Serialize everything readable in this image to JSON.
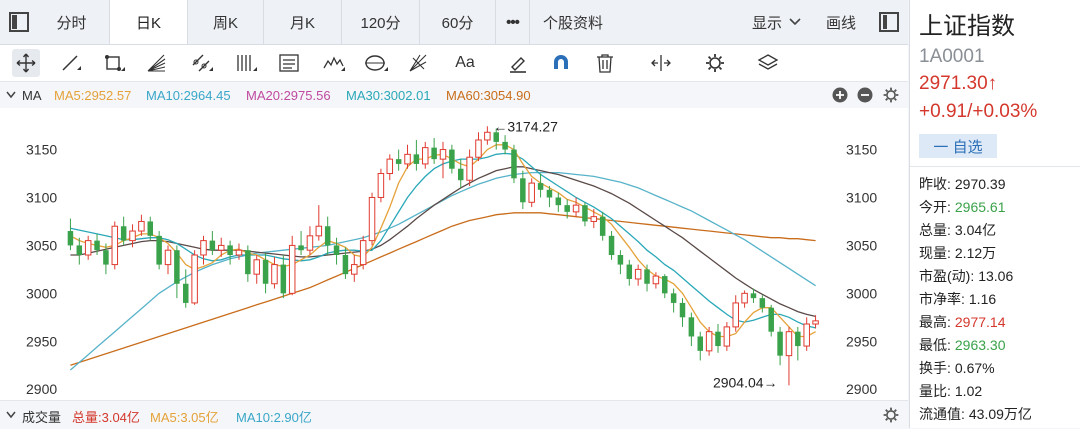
{
  "tabs": [
    {
      "label": "分时"
    },
    {
      "label": "日K"
    },
    {
      "label": "周K"
    },
    {
      "label": "月K"
    },
    {
      "label": "120分"
    },
    {
      "label": "60分"
    }
  ],
  "more_label": "•••",
  "profile_tab": "个股资料",
  "display_label": "显示",
  "draw_label": "画线",
  "ma_bar": {
    "label": "MA",
    "ma5": "MA5:2952.57",
    "ma10": "MA10:2964.45",
    "ma20": "MA20:2975.56",
    "ma30": "MA30:3002.01",
    "ma60": "MA60:3054.90"
  },
  "volume_bar": {
    "label": "成交量",
    "total": "总量:3.04亿",
    "ma5": "MA5:3.05亿",
    "ma10": "MA10:2.90亿"
  },
  "colors": {
    "up": "#e03a2f",
    "down": "#3aa24a",
    "ma5": "#e5a23a",
    "ma10": "#3aa7c8",
    "ma20": "#c04aa0",
    "ma30": "#2aa8b8",
    "ma60": "#c96d1c",
    "ma10_line": "#57b3c9",
    "ma20_line": "#5a4a48"
  },
  "chart_data": {
    "type": "candlestick",
    "y_ticks": [
      "3150",
      "3100",
      "3050",
      "3000",
      "2950",
      "2900"
    ],
    "ylim": [
      2895,
      3185
    ],
    "high_label": "←3174.27",
    "low_label": "2904.04→",
    "high_value": 3174.27,
    "low_value": 2904.04,
    "candles": [
      [
        3065,
        3050,
        3078,
        3045
      ],
      [
        3050,
        3040,
        3058,
        3030
      ],
      [
        3040,
        3055,
        3060,
        3035
      ],
      [
        3055,
        3045,
        3062,
        3040
      ],
      [
        3045,
        3030,
        3052,
        3020
      ],
      [
        3030,
        3070,
        3075,
        3025
      ],
      [
        3070,
        3055,
        3080,
        3050
      ],
      [
        3055,
        3065,
        3072,
        3048
      ],
      [
        3065,
        3075,
        3082,
        3060
      ],
      [
        3075,
        3060,
        3080,
        3055
      ],
      [
        3060,
        3030,
        3065,
        3025
      ],
      [
        3030,
        3045,
        3050,
        3020
      ],
      [
        3045,
        3010,
        3050,
        2995
      ],
      [
        3010,
        2990,
        3025,
        2985
      ],
      [
        2990,
        3040,
        3045,
        2988
      ],
      [
        3040,
        3055,
        3060,
        3030
      ],
      [
        3055,
        3045,
        3065,
        3040
      ],
      [
        3045,
        3050,
        3058,
        3038
      ],
      [
        3050,
        3040,
        3055,
        3030
      ],
      [
        3040,
        3045,
        3052,
        3035
      ],
      [
        3045,
        3020,
        3050,
        3012
      ],
      [
        3020,
        3035,
        3040,
        3010
      ],
      [
        3035,
        3010,
        3042,
        3000
      ],
      [
        3010,
        3030,
        3038,
        3005
      ],
      [
        3030,
        3000,
        3040,
        2995
      ],
      [
        3000,
        3050,
        3060,
        2998
      ],
      [
        3050,
        3045,
        3065,
        3040
      ],
      [
        3045,
        3060,
        3070,
        3040
      ],
      [
        3060,
        3070,
        3092,
        3055
      ],
      [
        3070,
        3050,
        3080,
        3040
      ],
      [
        3050,
        3040,
        3058,
        3030
      ],
      [
        3040,
        3020,
        3048,
        3015
      ],
      [
        3020,
        3030,
        3040,
        3012
      ],
      [
        3030,
        3055,
        3060,
        3025
      ],
      [
        3055,
        3100,
        3105,
        3050
      ],
      [
        3100,
        3125,
        3130,
        3095
      ],
      [
        3125,
        3140,
        3145,
        3118
      ],
      [
        3140,
        3135,
        3150,
        3128
      ],
      [
        3135,
        3145,
        3155,
        3130
      ],
      [
        3145,
        3135,
        3160,
        3128
      ],
      [
        3135,
        3152,
        3158,
        3130
      ],
      [
        3152,
        3140,
        3162,
        3135
      ],
      [
        3140,
        3150,
        3158,
        3120
      ],
      [
        3150,
        3130,
        3155,
        3125
      ],
      [
        3130,
        3118,
        3140,
        3110
      ],
      [
        3118,
        3142,
        3150,
        3112
      ],
      [
        3142,
        3160,
        3168,
        3138
      ],
      [
        3160,
        3168,
        3174.27,
        3155
      ],
      [
        3168,
        3158,
        3172,
        3150
      ],
      [
        3158,
        3150,
        3165,
        3145
      ],
      [
        3150,
        3120,
        3155,
        3115
      ],
      [
        3120,
        3095,
        3128,
        3088
      ],
      [
        3095,
        3115,
        3120,
        3090
      ],
      [
        3115,
        3108,
        3125,
        3100
      ],
      [
        3108,
        3100,
        3112,
        3090
      ],
      [
        3100,
        3092,
        3105,
        3085
      ],
      [
        3092,
        3085,
        3098,
        3078
      ],
      [
        3085,
        3092,
        3100,
        3080
      ],
      [
        3092,
        3075,
        3095,
        3070
      ],
      [
        3075,
        3080,
        3088,
        3068
      ],
      [
        3080,
        3060,
        3085,
        3055
      ],
      [
        3060,
        3040,
        3065,
        3035
      ],
      [
        3040,
        3030,
        3045,
        3020
      ],
      [
        3030,
        3015,
        3035,
        3008
      ],
      [
        3015,
        3025,
        3030,
        3008
      ],
      [
        3025,
        3010,
        3030,
        3002
      ],
      [
        3010,
        3018,
        3022,
        3005
      ],
      [
        3018,
        3000,
        3020,
        2995
      ],
      [
        3000,
        2990,
        3005,
        2980
      ],
      [
        2990,
        2975,
        2995,
        2965
      ],
      [
        2975,
        2955,
        2980,
        2945
      ],
      [
        2955,
        2940,
        2960,
        2930
      ],
      [
        2940,
        2960,
        2965,
        2935
      ],
      [
        2960,
        2945,
        2968,
        2938
      ],
      [
        2945,
        2965,
        2970,
        2940
      ],
      [
        2965,
        2990,
        2998,
        2960
      ],
      [
        2990,
        3000,
        3003,
        2985
      ],
      [
        3000,
        2995,
        3005,
        2990
      ],
      [
        2995,
        2985,
        2998,
        2980
      ],
      [
        2985,
        2960,
        2988,
        2955
      ],
      [
        2960,
        2935,
        2965,
        2925
      ],
      [
        2935,
        2960,
        2965,
        2904.04
      ],
      [
        2960,
        2945,
        2965,
        2930
      ],
      [
        2945,
        2968,
        2975,
        2940
      ],
      [
        2968,
        2971.3,
        2977.14,
        2963.3
      ]
    ],
    "ma5": [
      3060,
      3055,
      3052,
      3050,
      3048,
      3050,
      3055,
      3058,
      3062,
      3062,
      3058,
      3052,
      3042,
      3030,
      3025,
      3028,
      3032,
      3040,
      3045,
      3046,
      3042,
      3040,
      3035,
      3030,
      3028,
      3030,
      3035,
      3040,
      3048,
      3055,
      3052,
      3048,
      3040,
      3038,
      3048,
      3068,
      3090,
      3115,
      3132,
      3140,
      3140,
      3144,
      3145,
      3140,
      3135,
      3132,
      3140,
      3150,
      3155,
      3155,
      3150,
      3135,
      3122,
      3115,
      3110,
      3105,
      3098,
      3095,
      3090,
      3085,
      3080,
      3072,
      3060,
      3048,
      3035,
      3025,
      3018,
      3015,
      3010,
      3000,
      2985,
      2970,
      2960,
      2955,
      2955,
      2958,
      2970,
      2980,
      2985,
      2985,
      2975,
      2965,
      2955,
      2955,
      2960
    ],
    "ma10": [
      3068,
      3066,
      3064,
      3062,
      3060,
      3058,
      3056,
      3056,
      3057,
      3058,
      3058,
      3056,
      3052,
      3046,
      3040,
      3036,
      3034,
      3035,
      3038,
      3040,
      3040,
      3040,
      3040,
      3038,
      3036,
      3035,
      3034,
      3035,
      3038,
      3042,
      3044,
      3045,
      3045,
      3044,
      3045,
      3055,
      3070,
      3085,
      3100,
      3112,
      3122,
      3130,
      3135,
      3138,
      3140,
      3140,
      3140,
      3142,
      3145,
      3146,
      3145,
      3140,
      3132,
      3124,
      3118,
      3112,
      3106,
      3100,
      3095,
      3090,
      3084,
      3078,
      3070,
      3062,
      3054,
      3045,
      3038,
      3030,
      3024,
      3016,
      3008,
      3000,
      2992,
      2985,
      2978,
      2972,
      2970,
      2972,
      2975,
      2978,
      2978,
      2975,
      2970,
      2966,
      2964
    ],
    "ma20": [
      3040,
      3040,
      3042,
      3044,
      3046,
      3048,
      3050,
      3052,
      3054,
      3055,
      3055,
      3054,
      3052,
      3050,
      3048,
      3046,
      3045,
      3045,
      3045,
      3045,
      3044,
      3043,
      3042,
      3041,
      3040,
      3039,
      3038,
      3038,
      3039,
      3040,
      3041,
      3042,
      3043,
      3044,
      3046,
      3050,
      3056,
      3063,
      3070,
      3078,
      3085,
      3092,
      3098,
      3104,
      3110,
      3115,
      3120,
      3124,
      3128,
      3130,
      3132,
      3132,
      3130,
      3128,
      3126,
      3124,
      3121,
      3118,
      3115,
      3112,
      3108,
      3104,
      3099,
      3094,
      3088,
      3082,
      3076,
      3070,
      3064,
      3058,
      3051,
      3044,
      3037,
      3030,
      3023,
      3016,
      3010,
      3004,
      2999,
      2994,
      2989,
      2985,
      2981,
      2978,
      2976
    ],
    "ma30": [
      2920,
      2928,
      2936,
      2944,
      2952,
      2960,
      2968,
      2976,
      2984,
      2992,
      3000,
      3006,
      3012,
      3017,
      3022,
      3026,
      3030,
      3033,
      3036,
      3038,
      3040,
      3042,
      3043,
      3044,
      3045,
      3046,
      3047,
      3048,
      3049,
      3050,
      3052,
      3054,
      3056,
      3058,
      3061,
      3064,
      3068,
      3072,
      3077,
      3082,
      3087,
      3092,
      3097,
      3102,
      3106,
      3110,
      3114,
      3117,
      3120,
      3122,
      3124,
      3125,
      3126,
      3126,
      3126,
      3126,
      3125,
      3124,
      3123,
      3122,
      3120,
      3118,
      3116,
      3113,
      3110,
      3106,
      3102,
      3098,
      3094,
      3090,
      3086,
      3081,
      3076,
      3071,
      3066,
      3061,
      3056,
      3050,
      3044,
      3038,
      3032,
      3026,
      3020,
      3014,
      3008
    ],
    "ma60": [
      2925,
      2928,
      2931,
      2934,
      2937,
      2940,
      2943,
      2946,
      2949,
      2952,
      2955,
      2958,
      2961,
      2964,
      2967,
      2970,
      2973,
      2976,
      2979,
      2982,
      2985,
      2988,
      2991,
      2994,
      2997,
      3000,
      3003,
      3006,
      3010,
      3014,
      3018,
      3022,
      3026,
      3030,
      3034,
      3038,
      3042,
      3046,
      3050,
      3054,
      3058,
      3062,
      3066,
      3070,
      3073,
      3076,
      3078,
      3080,
      3082,
      3083,
      3084,
      3084,
      3084,
      3084,
      3083,
      3082,
      3081,
      3080,
      3079,
      3078,
      3077,
      3076,
      3075,
      3074,
      3073,
      3072,
      3071,
      3070,
      3069,
      3068,
      3067,
      3066,
      3065,
      3064,
      3063,
      3062,
      3061,
      3060,
      3059,
      3058,
      3058,
      3057,
      3057,
      3056,
      3055
    ]
  },
  "panel": {
    "title": "上证指数",
    "code": "1A0001",
    "price": "2971.30↑",
    "change": "+0.91/+0.03%",
    "fav": "一 自选",
    "stats": [
      {
        "k": "昨收:",
        "v": "2970.39",
        "c": "#222"
      },
      {
        "k": "今开:",
        "v": "2965.61",
        "c": "#3aa24a"
      },
      {
        "k": "总量:",
        "v": "3.04亿",
        "c": "#222"
      },
      {
        "k": "现量:",
        "v": "2.12万",
        "c": "#222"
      },
      {
        "k": "市盈(动):",
        "v": "13.06",
        "c": "#222"
      },
      {
        "k": "市净率:",
        "v": "1.16",
        "c": "#222"
      },
      {
        "k": "最高:",
        "v": "2977.14",
        "c": "#d4372c"
      },
      {
        "k": "最低:",
        "v": "2963.30",
        "c": "#3aa24a"
      },
      {
        "k": "换手:",
        "v": "0.67%",
        "c": "#222"
      },
      {
        "k": "量比:",
        "v": "1.02",
        "c": "#222"
      },
      {
        "k": "流通值:",
        "v": "43.09万亿",
        "c": "#222"
      }
    ]
  }
}
